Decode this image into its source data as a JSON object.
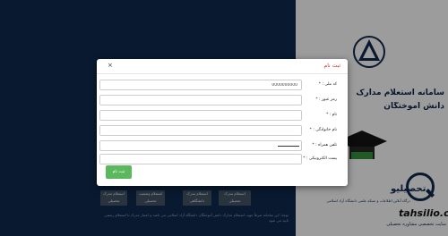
{
  "background": {
    "site_title_line1": "سامانه استعلام مدارک",
    "site_title_line2": "دانش آموختگان",
    "buttons": [
      {
        "label": "استعلام مدرک تحصیلی"
      },
      {
        "label": "استعلام وضعیت تحصیلی"
      },
      {
        "label": "استعلام مدرک دانشگاهی"
      },
      {
        "label": "استعلام مدرک تحصیلی"
      }
    ],
    "notice": "توجه: این سامانه صرفاً جهت استعلام مدارک دانش آموختگان دانشگاه آزاد اسلامی می باشد و اعتبار مدرک با استعلام رسمی تایید می شود"
  },
  "watermark": {
    "logo_text": "تحصیلیو",
    "description": "درگاه آنلاین اطلاعات و شبکه علمی دانشگاه آزاد اسلامی",
    "site": "tahsilio.cc",
    "subtitle": "سایت تخصصی مشاوره تحصیلی"
  },
  "modal": {
    "title": "ثبت نام",
    "close_glyph": "×",
    "fields": [
      {
        "label": "کد ملی : *",
        "value": "0000000000",
        "placeholder": ""
      },
      {
        "label": "رمز عبور : *",
        "value": "",
        "placeholder": ""
      },
      {
        "label": "نام : *",
        "value": "",
        "placeholder": ""
      },
      {
        "label": "نام خانوادگی : *",
        "value": "",
        "placeholder": ""
      },
      {
        "label": "تلفن همراه : *",
        "value": "",
        "placeholder": ""
      },
      {
        "label": "پست الکترونیکی : *",
        "value": "",
        "placeholder": ""
      }
    ],
    "submit_label": "ثبت نام"
  },
  "colors": {
    "navy": "#0d2342",
    "submit": "#5cb85c",
    "title": "#c0392b"
  }
}
